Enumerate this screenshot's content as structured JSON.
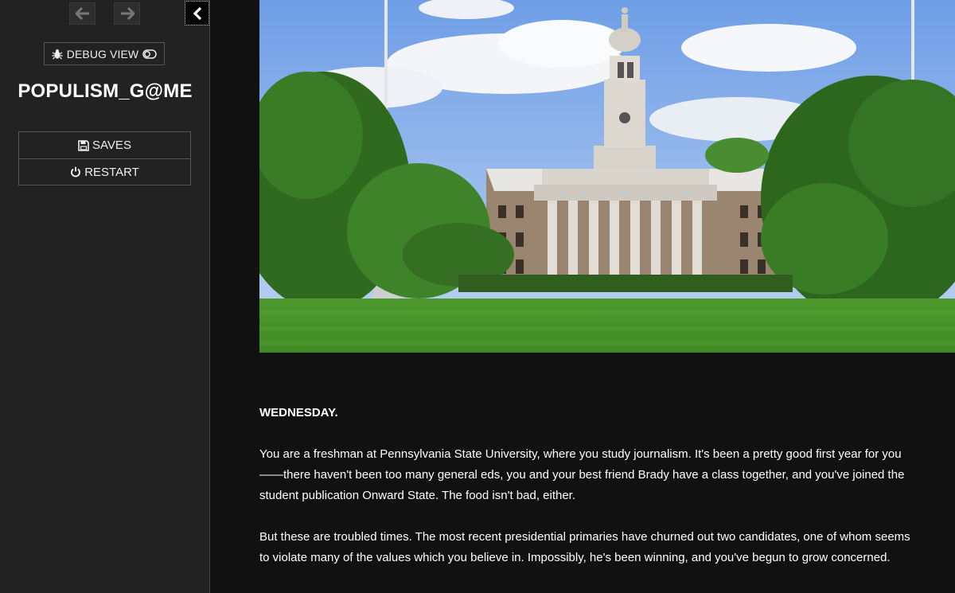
{
  "sidebar": {
    "history": {
      "back_icon": "arrow-left-icon",
      "forward_icon": "arrow-right-icon"
    },
    "collapse_icon": "chevron-left-icon",
    "debug": {
      "label": "DEBUG VIEW",
      "icon": "bug-icon",
      "toggle_icon": "toggle-off-icon"
    },
    "title": "POPULISM_G@ME",
    "menu": [
      {
        "label": "SAVES",
        "icon": "floppy-disk-icon"
      },
      {
        "label": "RESTART",
        "icon": "power-icon"
      }
    ]
  },
  "story": {
    "image_subject": "old-main-building-photo",
    "day": "WEDNESDAY.",
    "paragraphs": [
      "You are a freshman at Pennsylvania State University, where you study journalism. It's been a pretty good first year for you——there haven't been too many general eds, you and your best friend Brady have a class together, and you've joined the student publication Onward State. The food isn't bad, either.",
      "But these are troubled times. The most recent presidential primaries have churned out two candidates, one of whom seems to violate many of the values which you believe in. Impossibly, he's been winning, and you've begun to grow concerned."
    ]
  },
  "colors": {
    "sidebar_bg": "#222222",
    "story_bg": "#111111",
    "text": "#ffffff",
    "border": "#555555"
  }
}
